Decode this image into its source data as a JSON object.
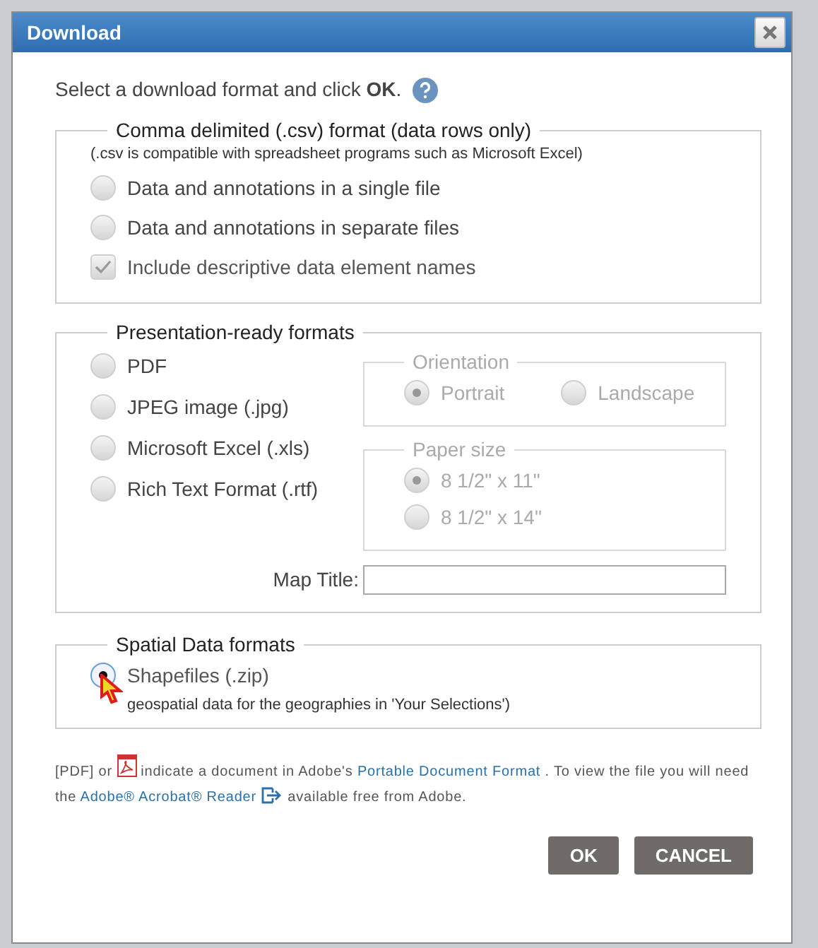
{
  "window": {
    "title": "Download"
  },
  "intro": "Select a download format and click **OK**.",
  "csv": {
    "legend": "Comma delimited (.csv) format (data rows only)",
    "note": "(.csv is compatible with spreadsheet programs such as Microsoft Excel)",
    "options": [
      {
        "kind": "radio",
        "label": "Data and annotations in a single file",
        "selected": false
      },
      {
        "kind": "radio",
        "label": "Data and annotations in separate files",
        "selected": false
      },
      {
        "kind": "checkbox",
        "label": "Include descriptive data element names",
        "checked": true,
        "disabled": true
      }
    ]
  },
  "presentation": {
    "legend": "Presentation-ready formats",
    "formats": [
      {
        "label": "PDF",
        "selected": false
      },
      {
        "label": "JPEG image (.jpg)",
        "selected": false
      },
      {
        "label": "Microsoft Excel (.xls)",
        "selected": false
      },
      {
        "label": "Rich Text Format (.rtf)",
        "selected": false
      }
    ],
    "orientation": {
      "legend": "Orientation",
      "disabled": true,
      "options": [
        {
          "label": "Portrait",
          "selected": true
        },
        {
          "label": "Landscape",
          "selected": false
        }
      ]
    },
    "paper_size": {
      "legend": "Paper size",
      "disabled": true,
      "options": [
        {
          "label": "8 1/2\" x 11\"",
          "selected": true
        },
        {
          "label": "8 1/2\" x 14\"",
          "selected": false
        }
      ]
    },
    "map_title": {
      "label": "Map Title:"
    }
  },
  "spatial": {
    "legend": "Spatial Data formats",
    "options": [
      {
        "label": "Shapefiles (.zip)",
        "selected": true,
        "description": "geospatial data for the geographies in 'Your Selections')"
      }
    ]
  },
  "footer": [
    {
      "kind": "text",
      "text": "[PDF] or"
    },
    {
      "kind": "pdf-icon"
    },
    {
      "kind": "text",
      "text": "indicate a document in Adobe's"
    },
    {
      "kind": "link",
      "text": "Portable Document Format"
    },
    {
      "kind": "text",
      "text": ". To view the file you will need the"
    },
    {
      "kind": "link",
      "text": "Adobe® Acrobat® Reader"
    },
    {
      "kind": "exit-icon"
    },
    {
      "kind": "text",
      "text": "available free from Adobe."
    }
  ],
  "buttons": [
    "OK",
    "CANCEL"
  ]
}
